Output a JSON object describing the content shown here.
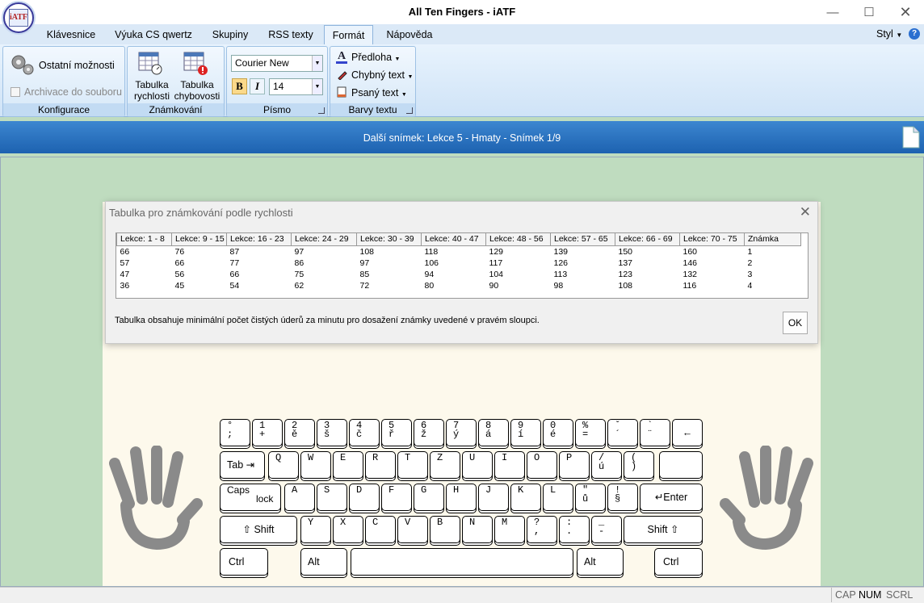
{
  "window": {
    "title": "All Ten Fingers - iATF",
    "logo_text": "iATF"
  },
  "tabs": [
    {
      "label": "Klávesnice"
    },
    {
      "label": "Výuka CS qwertz"
    },
    {
      "label": "Skupiny"
    },
    {
      "label": "RSS texty"
    },
    {
      "label": "Formát"
    },
    {
      "label": "Nápověda"
    }
  ],
  "style_menu": "Styl",
  "ribbon": {
    "konfigurace": {
      "other_options": "Ostatní možnosti",
      "archive": "Archivace do souboru",
      "label": "Konfigurace"
    },
    "znamkovani": {
      "speed_table": "Tabulka rychlosti",
      "error_table": "Tabulka chybovosti",
      "label": "Známkování"
    },
    "pismo": {
      "font": "Courier New",
      "size": "14",
      "bold": "B",
      "italic": "I",
      "label": "Písmo"
    },
    "barvy": {
      "template": "Předloha",
      "wrong": "Chybný text",
      "typed": "Psaný text",
      "label": "Barvy textu"
    }
  },
  "slide_info": "Další snímek: Lekce 5 - Hmaty - Snímek 1/9",
  "dialog": {
    "title": "Tabulka pro známkování podle rychlosti",
    "columns": [
      "Lekce: 1 - 8",
      "Lekce: 9 - 15",
      "Lekce: 16 - 23",
      "Lekce: 24 - 29",
      "Lekce: 30 - 39",
      "Lekce: 40 - 47",
      "Lekce: 48 - 56",
      "Lekce: 57 - 65",
      "Lekce: 66 - 69",
      "Lekce: 70 - 75",
      "Známka"
    ],
    "rows": [
      [
        "66",
        "76",
        "87",
        "97",
        "108",
        "118",
        "129",
        "139",
        "150",
        "160",
        "1"
      ],
      [
        "57",
        "66",
        "77",
        "86",
        "97",
        "106",
        "117",
        "126",
        "137",
        "146",
        "2"
      ],
      [
        "47",
        "56",
        "66",
        "75",
        "85",
        "94",
        "104",
        "113",
        "123",
        "132",
        "3"
      ],
      [
        "36",
        "45",
        "54",
        "62",
        "72",
        "80",
        "90",
        "98",
        "108",
        "116",
        "4"
      ]
    ],
    "info": "Tabulka obsahuje minimální počet čistých úderů za minutu pro dosažení známky uvedené v pravém sloupci.",
    "ok": "OK"
  },
  "keyboard": {
    "row1": [
      [
        "°",
        ";"
      ],
      [
        "1",
        "+"
      ],
      [
        "2",
        "ě"
      ],
      [
        "3",
        "š"
      ],
      [
        "4",
        "č"
      ],
      [
        "5",
        "ř"
      ],
      [
        "6",
        "ž"
      ],
      [
        "7",
        "ý"
      ],
      [
        "8",
        "á"
      ],
      [
        "9",
        "í"
      ],
      [
        "0",
        "é"
      ],
      [
        "%",
        "="
      ],
      [
        "ˇ",
        "´"
      ],
      [
        "`",
        "¨"
      ]
    ],
    "row2": [
      "Q",
      "W",
      "E",
      "R",
      "T",
      "Z",
      "U",
      "I",
      "O",
      "P"
    ],
    "row2_extra": [
      [
        "/",
        "ú"
      ],
      [
        "(",
        ")"
      ]
    ],
    "row3": [
      "A",
      "S",
      "D",
      "F",
      "G",
      "H",
      "J",
      "K",
      "L"
    ],
    "row3_extra": [
      [
        "\"",
        "ů"
      ],
      [
        "!",
        "§"
      ]
    ],
    "row4": [
      "Y",
      "X",
      "C",
      "V",
      "B",
      "N",
      "M"
    ],
    "row4_extra": [
      [
        "?",
        ","
      ],
      [
        ":",
        "."
      ],
      [
        "_",
        "-"
      ]
    ],
    "backspace": "←",
    "tab": "Tab",
    "caps": "Caps",
    "lock": "lock",
    "enter": "Enter",
    "shift": "Shift",
    "ctrl": "Ctrl",
    "alt": "Alt"
  },
  "status": {
    "cap": "CAP",
    "num": "NUM",
    "scrl": "SCRL"
  }
}
